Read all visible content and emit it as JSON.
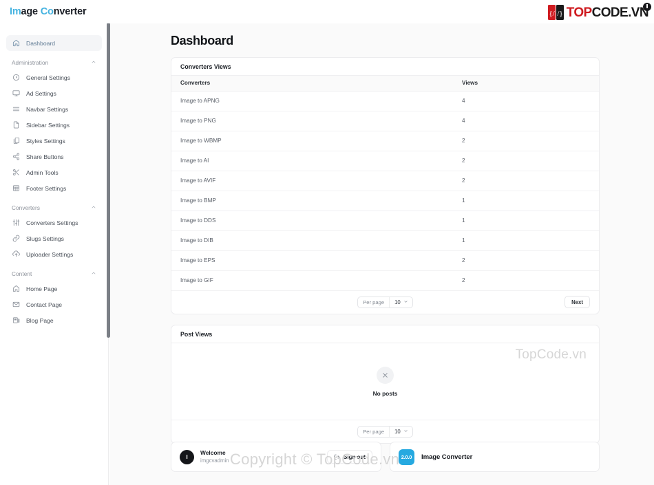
{
  "topbar": {
    "brand_accent_1": "Im",
    "brand_mid_1": "age ",
    "brand_accent_2": "Co",
    "brand_mid_2": "nverter",
    "logo_text_top": "TOP",
    "logo_text_code": "CODE.VN",
    "accent_color": "#45b3e0",
    "logo_red": "#cf1b20"
  },
  "sidebar": {
    "dashboard": {
      "label": "Dashboard",
      "icon": "home-icon",
      "active": true
    },
    "groups": [
      {
        "label": "Administration",
        "chevron": "chevron-up-icon",
        "items": [
          {
            "label": "General Settings",
            "icon": "gear-icon"
          },
          {
            "label": "Ad Settings",
            "icon": "monitor-icon"
          },
          {
            "label": "Navbar Settings",
            "icon": "menu-lines-icon"
          },
          {
            "label": "Sidebar Settings",
            "icon": "file-icon"
          },
          {
            "label": "Styles Settings",
            "icon": "copy-icon"
          },
          {
            "label": "Share Buttons",
            "icon": "share-icon"
          },
          {
            "label": "Admin Tools",
            "icon": "scissors-icon"
          },
          {
            "label": "Footer Settings",
            "icon": "table-icon"
          }
        ]
      },
      {
        "label": "Converters",
        "chevron": "chevron-up-icon",
        "items": [
          {
            "label": "Converters Settings",
            "icon": "sliders-icon"
          },
          {
            "label": "Slugs Settings",
            "icon": "link-icon"
          },
          {
            "label": "Uploader Settings",
            "icon": "upload-cloud-icon"
          }
        ]
      },
      {
        "label": "Content",
        "chevron": "chevron-up-icon",
        "items": [
          {
            "label": "Home Page",
            "icon": "home-icon"
          },
          {
            "label": "Contact Page",
            "icon": "mail-icon"
          },
          {
            "label": "Blog Page",
            "icon": "blog-icon"
          }
        ]
      }
    ]
  },
  "main": {
    "page_title": "Dashboard",
    "converters_card": {
      "title": "Converters Views",
      "columns": [
        "Converters",
        "Views"
      ],
      "rows": [
        {
          "converter": "Image to APNG",
          "views": "4"
        },
        {
          "converter": "Image to PNG",
          "views": "4"
        },
        {
          "converter": "Image to WBMP",
          "views": "2"
        },
        {
          "converter": "Image to AI",
          "views": "2"
        },
        {
          "converter": "Image to AVIF",
          "views": "2"
        },
        {
          "converter": "Image to BMP",
          "views": "1"
        },
        {
          "converter": "Image to DDS",
          "views": "1"
        },
        {
          "converter": "Image to DIB",
          "views": "1"
        },
        {
          "converter": "Image to EPS",
          "views": "2"
        },
        {
          "converter": "Image to GIF",
          "views": "2"
        }
      ],
      "pager": {
        "per_page_label": "Per page",
        "per_page_value": "10",
        "caret": "chevron-down-icon",
        "next_label": "Next"
      }
    },
    "posts_card": {
      "title": "Post Views",
      "empty_icon": "close-x-icon",
      "empty_text": "No posts",
      "pager": {
        "per_page_label": "Per page",
        "per_page_value": "10",
        "caret": "chevron-down-icon"
      }
    },
    "user_card": {
      "avatar_initial": "I",
      "welcome_label": "Welcome",
      "username": "imgcvadmin",
      "signout_label": "Sign out",
      "signout_icon": "logout-icon"
    },
    "app_card": {
      "version_badge": "2.0.0",
      "app_name": "Image Converter",
      "badge_color": "#26a9e0"
    }
  },
  "watermarks": {
    "top": "TopCode.vn",
    "bottom": "Copyright © TopCode.vn"
  }
}
